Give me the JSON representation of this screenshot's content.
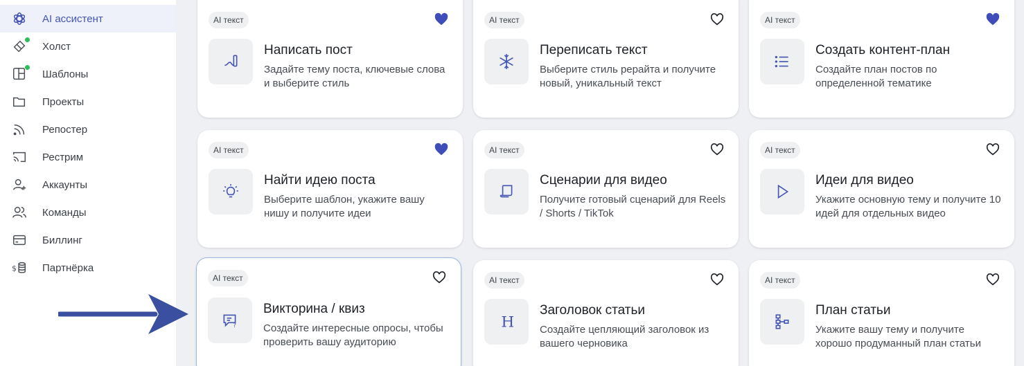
{
  "sidebar": {
    "items": [
      {
        "label": "AI ассистент",
        "icon": "openai-icon",
        "active": true
      },
      {
        "label": "Холст",
        "icon": "canvas-icon",
        "dot": true
      },
      {
        "label": "Шаблоны",
        "icon": "templates-icon",
        "dot": true
      },
      {
        "label": "Проекты",
        "icon": "folder-icon"
      },
      {
        "label": "Репостер",
        "icon": "rss-icon"
      },
      {
        "label": "Рестрим",
        "icon": "cast-icon"
      },
      {
        "label": "Аккаунты",
        "icon": "user-plus-icon"
      },
      {
        "label": "Команды",
        "icon": "users-icon"
      },
      {
        "label": "Биллинг",
        "icon": "credit-card-icon"
      },
      {
        "label": "Партнёрка",
        "icon": "dollar-coins-icon"
      }
    ]
  },
  "colors": {
    "accent": "#4354b3",
    "heart_filled": "#3f4db8",
    "arrow": "#3a4fa0",
    "online_dot": "#2dbd5a"
  },
  "cards": [
    {
      "badge": "AI текст",
      "title": "Написать пост",
      "desc": "Задайте тему поста, ключевые слова и выберите стиль",
      "icon": "pen-icon",
      "favorite": true
    },
    {
      "badge": "AI текст",
      "title": "Переписать текст",
      "desc": "Выберите стиль рерайта и получите новый, уникальный текст",
      "icon": "snowflake-icon",
      "favorite": false
    },
    {
      "badge": "AI текст",
      "title": "Создать контент-план",
      "desc": "Создайте план постов по определенной тематике",
      "icon": "list-icon",
      "favorite": true
    },
    {
      "badge": "AI текст",
      "title": "Найти идею поста",
      "desc": "Выберите шаблон, укажите вашу нишу и получите идеи",
      "icon": "lightbulb-icon",
      "favorite": true
    },
    {
      "badge": "AI текст",
      "title": "Сценарии для видео",
      "desc": "Получите готовый сценарий для Reels / Shorts / TikTok",
      "icon": "scroll-icon",
      "favorite": false
    },
    {
      "badge": "AI текст",
      "title": "Идеи для видео",
      "desc": "Укажите основную тему и получите 10 идей для отдельных видео",
      "icon": "play-icon",
      "favorite": false
    },
    {
      "badge": "AI текст",
      "title": "Викторина / квиз",
      "desc": "Создайте интересные опросы, чтобы проверить вашу аудиторию",
      "icon": "quiz-message-icon",
      "favorite": false
    },
    {
      "badge": "AI текст",
      "title": "Заголовок статьи",
      "desc": "Создайте цепляющий заголовок из вашего черновика",
      "icon": "heading-icon",
      "favorite": false
    },
    {
      "badge": "AI текст",
      "title": "План статьи",
      "desc": "Укажите вашу тему и получите хорошо продуманный план статьи",
      "icon": "hierarchy-icon",
      "favorite": false
    }
  ]
}
